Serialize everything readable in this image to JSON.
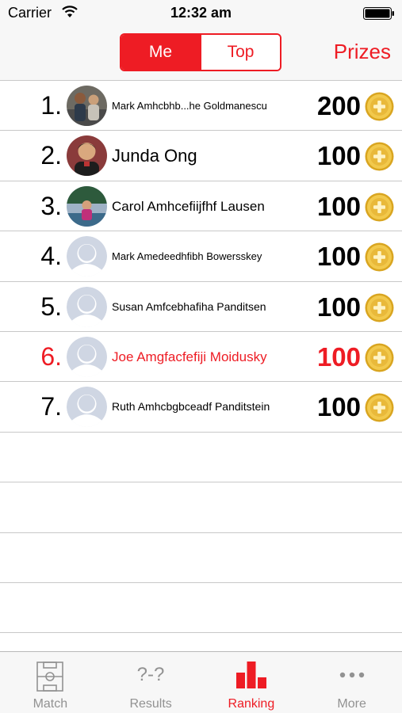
{
  "status_bar": {
    "carrier": "Carrier",
    "time": "12:32 am"
  },
  "header": {
    "segments": [
      {
        "label": "Me",
        "active": true
      },
      {
        "label": "Top",
        "active": false
      }
    ],
    "prizes_label": "Prizes"
  },
  "ranking": [
    {
      "rank": "1.",
      "name": "Mark Amhcbhb...he Goldmanescu",
      "score": "200",
      "avatar": "photo-1",
      "name_size": "small",
      "me": false
    },
    {
      "rank": "2.",
      "name": "Junda Ong",
      "score": "100",
      "avatar": "photo-2",
      "name_size": "large",
      "me": false
    },
    {
      "rank": "3.",
      "name": "Carol Amhcefiijfhf Lausen",
      "score": "100",
      "avatar": "photo-3",
      "name_size": "medium",
      "me": false
    },
    {
      "rank": "4.",
      "name": "Mark Amedeedhfibh Bowersskey",
      "score": "100",
      "avatar": "default-silhouette",
      "name_size": "small",
      "me": false
    },
    {
      "rank": "5.",
      "name": "Susan Amfcebhafiha Panditsen",
      "score": "100",
      "avatar": "default-silhouette",
      "name_size": "small-plus",
      "me": false
    },
    {
      "rank": "6.",
      "name": "Joe Amgfacfefiji Moidusky",
      "score": "100",
      "avatar": "default-silhouette",
      "name_size": "medium",
      "me": true
    },
    {
      "rank": "7.",
      "name": "Ruth Amhcbgbceadf Panditstein",
      "score": "100",
      "avatar": "default-silhouette",
      "name_size": "small-plus",
      "me": false
    }
  ],
  "empty_row_count": 4,
  "tabs": [
    {
      "label": "Match",
      "icon": "soccer-field-icon",
      "active": false
    },
    {
      "label": "Results",
      "icon": "score-question-icon",
      "active": false
    },
    {
      "label": "Ranking",
      "icon": "bar-chart-icon",
      "active": true
    },
    {
      "label": "More",
      "icon": "more-dots-icon",
      "active": false
    }
  ],
  "colors": {
    "accent": "#ee1c24",
    "tab_inactive": "#929292",
    "coin": "#f2c94c",
    "divider": "#c8c8c8"
  }
}
